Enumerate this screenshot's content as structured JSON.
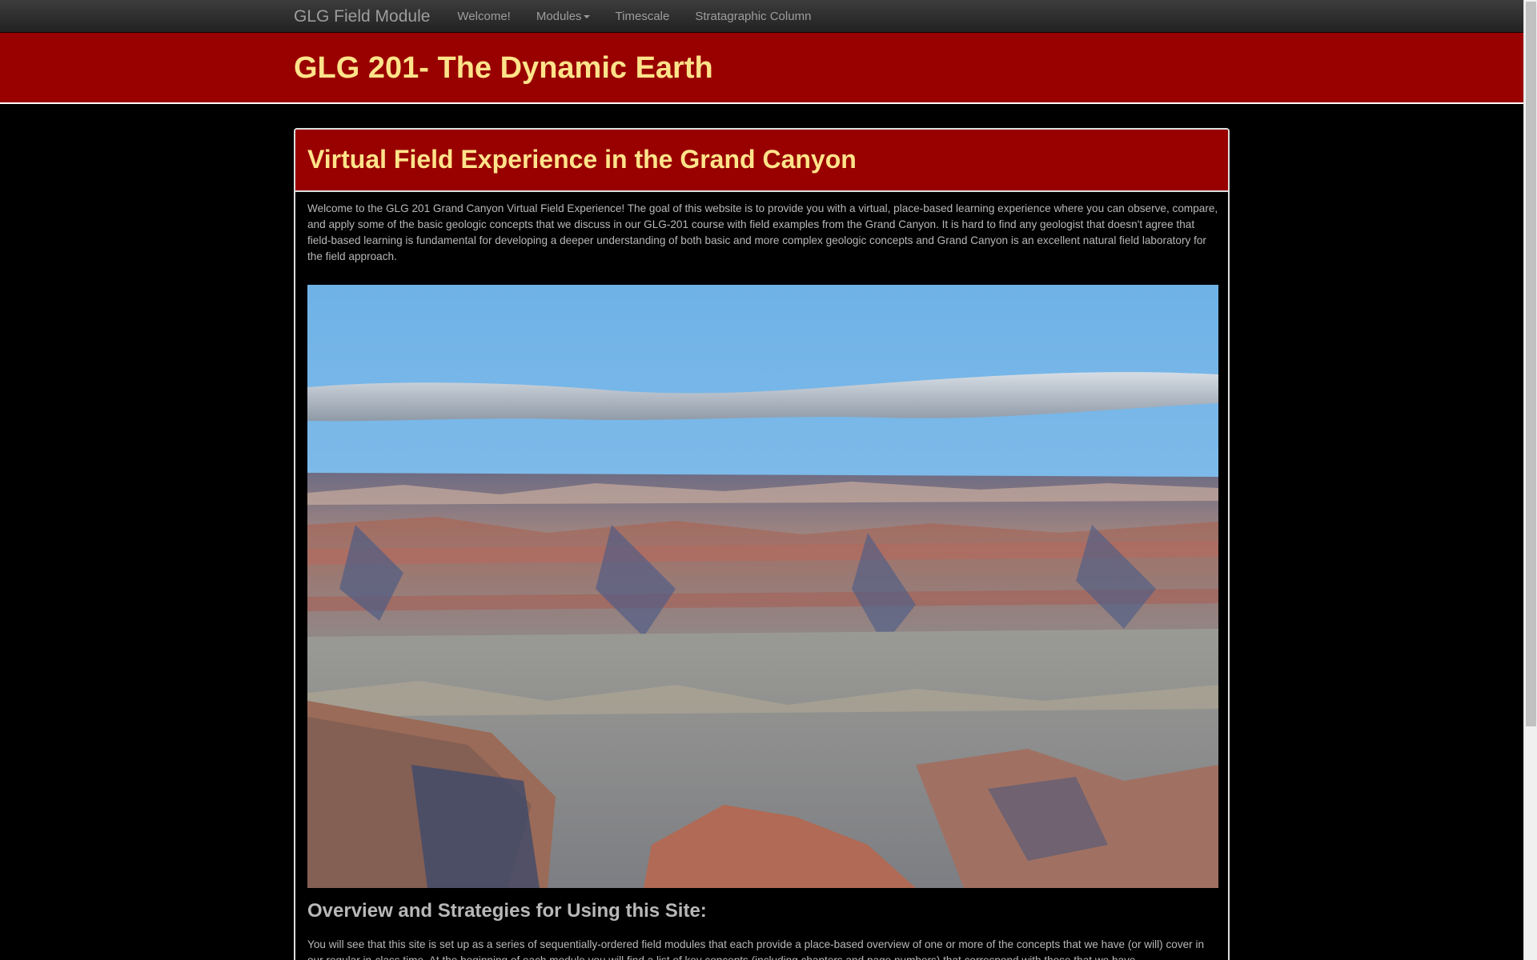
{
  "navbar": {
    "brand": "GLG Field Module",
    "links": [
      "Welcome!",
      "Modules",
      "Timescale",
      "Stratagraphic Column"
    ]
  },
  "header": {
    "title": "GLG 201- The Dynamic Earth"
  },
  "panel": {
    "heading": "Virtual Field Experience in the Grand Canyon",
    "intro": "Welcome to the GLG 201 Grand Canyon Virtual Field Experience! The goal of this website is to provide you with a virtual, place-based learning experience where you can observe, compare, and apply some of the basic geologic concepts that we discuss in our GLG-201 course with field examples from the Grand Canyon. It is hard to find any geologist that doesn't agree that field-based learning is fundamental for developing a deeper understanding of both basic and more complex geologic concepts and Grand Canyon is an excellent natural field laboratory for the field approach.",
    "section_title": "Overview and Strategies for Using this Site:",
    "section_text": "You will see that this site is set up as a series of sequentially-ordered field modules that each provide a place-based overview of one or more of the concepts that we have (or will) cover in our regular in-class time. At the beginning of each module you will find a list of key concepts (including chapters and page numbers) that correspond with those that we have"
  },
  "colors": {
    "banner": "#990000",
    "title_text": "#ffe38a",
    "body_text": "#b8b8b8"
  },
  "icons": {
    "modules_caret": "caret-down-icon"
  }
}
